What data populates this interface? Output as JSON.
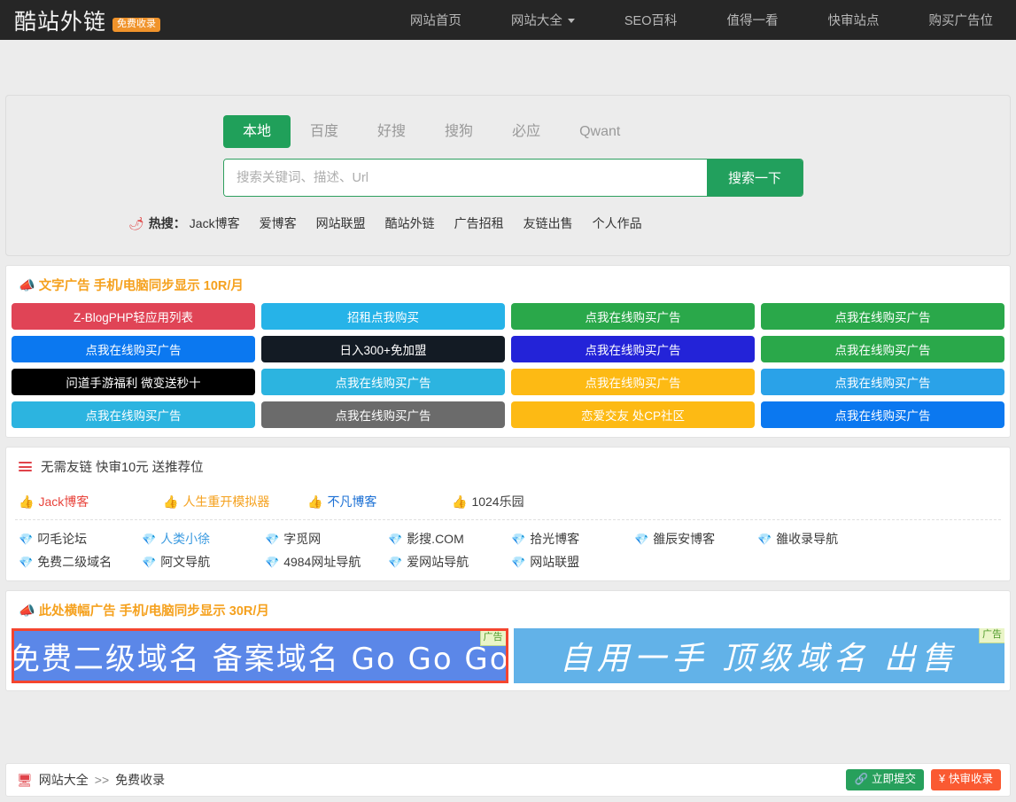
{
  "header": {
    "brand_name": "酷站外链",
    "brand_badge": "免费收录",
    "nav": [
      {
        "label": "网站首页",
        "has_caret": false
      },
      {
        "label": "网站大全",
        "has_caret": true
      },
      {
        "label": "SEO百科",
        "has_caret": false
      },
      {
        "label": "值得一看",
        "has_caret": false
      },
      {
        "label": "快审站点",
        "has_caret": false
      },
      {
        "label": "购买广告位",
        "has_caret": false
      }
    ]
  },
  "search": {
    "tabs": [
      {
        "label": "本地",
        "active": true
      },
      {
        "label": "百度",
        "active": false
      },
      {
        "label": "好搜",
        "active": false
      },
      {
        "label": "搜狗",
        "active": false
      },
      {
        "label": "必应",
        "active": false
      },
      {
        "label": "Qwant",
        "active": false
      }
    ],
    "placeholder": "搜索关键词、描述、Url",
    "value": "",
    "button_label": "搜索一下",
    "hot_icon": "fire-icon",
    "hot_label": "热搜：",
    "hot_links": [
      "Jack博客",
      "爱博客",
      "网站联盟",
      "酷站外链",
      "广告招租",
      "友链出售",
      "个人作品"
    ]
  },
  "text_ads": {
    "head_icon": "megaphone-icon",
    "head_title": "文字广告 手机/电脑同步显示 10R/月",
    "head_color": "#f5a11e",
    "items": [
      {
        "label": "Z-BlogPHP轻应用列表",
        "color": "#e04456"
      },
      {
        "label": "招租点我购买",
        "color": "#26b3e8"
      },
      {
        "label": "点我在线购买广告",
        "color": "#2aa84a"
      },
      {
        "label": "点我在线购买广告",
        "color": "#2aa84a"
      },
      {
        "label": "点我在线购买广告",
        "color": "#0b78f0"
      },
      {
        "label": "日入300+免加盟",
        "color": "#131b24"
      },
      {
        "label": "点我在线购买广告",
        "color": "#2323d8"
      },
      {
        "label": "点我在线购买广告",
        "color": "#2aa84a"
      },
      {
        "label": "问道手游福利 微变送秒十",
        "color": "#000000"
      },
      {
        "label": "点我在线购买广告",
        "color": "#2cb4e0"
      },
      {
        "label": "点我在线购买广告",
        "color": "#fdba14"
      },
      {
        "label": "点我在线购买广告",
        "color": "#2aa2e8"
      },
      {
        "label": "点我在线购买广告",
        "color": "#2cb4e0"
      },
      {
        "label": "点我在线购买广告",
        "color": "#6b6b6b"
      },
      {
        "label": "恋爱交友 处CP社区",
        "color": "#fdba14"
      },
      {
        "label": "点我在线购买广告",
        "color": "#0b78f0"
      }
    ]
  },
  "friend_links": {
    "head_icon": "hamburger-icon",
    "head_title": "无需友链 快审10元 送推荐位",
    "featured": [
      {
        "label": "Jack博客",
        "icon": "thumbs-up-icon",
        "color": "#e8443c"
      },
      {
        "label": "人生重开模拟器",
        "icon": "thumbs-up-icon",
        "color": "#f5a11e"
      },
      {
        "label": "不凡博客",
        "icon": "thumbs-up-icon",
        "color": "#1a6fd4"
      },
      {
        "label": "1024乐园",
        "icon": "thumbs-up-icon",
        "color": "#3c3c3c"
      }
    ],
    "items": [
      {
        "label": "叼毛论坛",
        "icon": "gem-icon",
        "color": "#3c3c3c"
      },
      {
        "label": "人类小徐",
        "icon": "gem-icon",
        "color": "#3a9ae0"
      },
      {
        "label": "字觅网",
        "icon": "gem-icon",
        "color": "#3c3c3c"
      },
      {
        "label": "影搜.COM",
        "icon": "gem-icon",
        "color": "#3c3c3c"
      },
      {
        "label": "拾光博客",
        "icon": "gem-icon",
        "color": "#3c3c3c"
      },
      {
        "label": "雒辰安博客",
        "icon": "gem-icon",
        "color": "#3c3c3c"
      },
      {
        "label": "雒收录导航",
        "icon": "gem-icon",
        "color": "#3c3c3c"
      },
      {
        "label": "免费二级域名",
        "icon": "gem-icon",
        "color": "#3c3c3c"
      },
      {
        "label": "阿文导航",
        "icon": "gem-icon",
        "color": "#3c3c3c"
      },
      {
        "label": "4984网址导航",
        "icon": "gem-icon",
        "color": "#3c3c3c"
      },
      {
        "label": "爱网站导航",
        "icon": "gem-icon",
        "color": "#3c3c3c"
      },
      {
        "label": "网站联盟",
        "icon": "gem-icon",
        "color": "#3c3c3c"
      }
    ]
  },
  "banner_ads": {
    "head_icon": "megaphone-icon",
    "head_title": "此处横幅广告 手机/电脑同步显示 30R/月",
    "head_color": "#f5a11e",
    "items": [
      {
        "text": "免费二级域名 备案域名 Go Go Go",
        "tag": "广告",
        "bg": "#5b87e8",
        "border": "#f4452f"
      },
      {
        "text": "自用一手 顶级域名 出售",
        "tag": "广告",
        "bg": "#62b2e8",
        "border": ""
      }
    ]
  },
  "footer": {
    "crumb_icon": "monitor-icon",
    "crumb_root": "网站大全",
    "crumb_sep": ">>",
    "crumb_current": "免费收录",
    "actions": [
      {
        "label": "立即提交",
        "icon": "link-icon",
        "color": "#27a05c"
      },
      {
        "label": "快审收录",
        "icon": "yen-icon",
        "color": "#fa5a32"
      }
    ]
  }
}
